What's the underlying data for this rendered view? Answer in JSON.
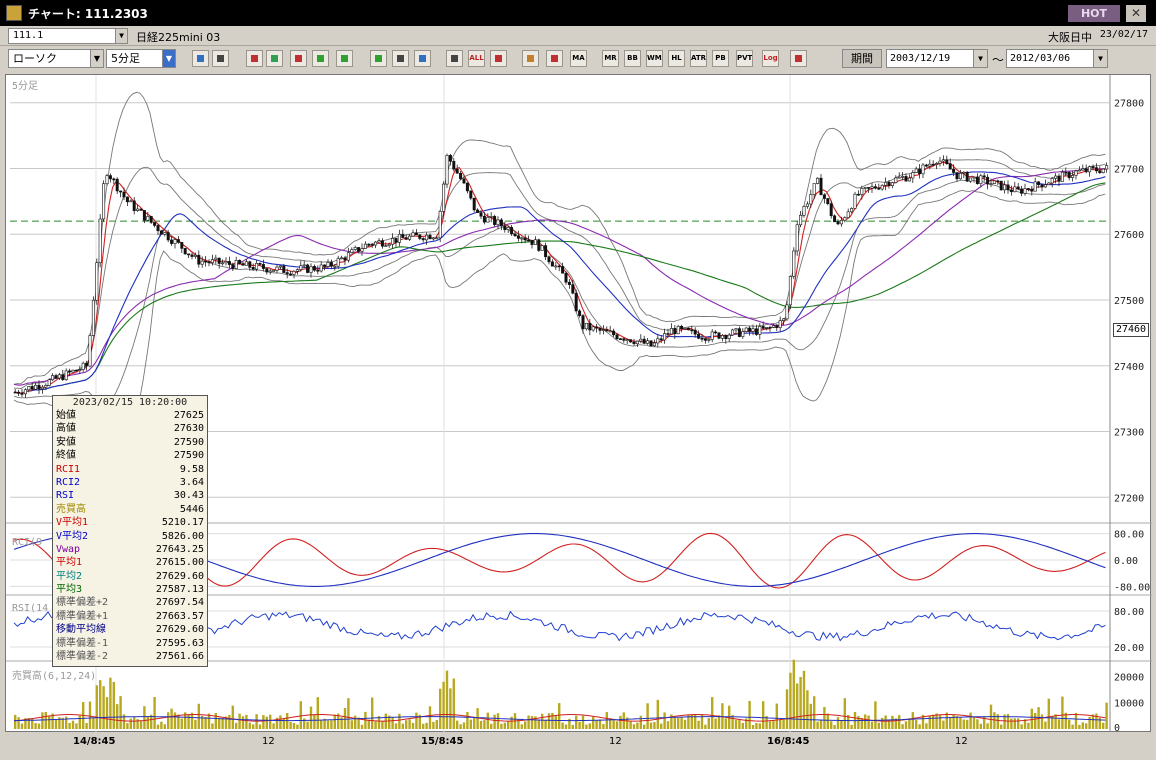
{
  "window": {
    "title": "チャート: 111.2303",
    "hot_label": "HOT",
    "close_label": "✕"
  },
  "symbol_bar": {
    "code": "111.1",
    "name": "日経225mini 03",
    "session": "大阪日中",
    "date": "23/02/17"
  },
  "toolbar": {
    "chart_type": "ローソク",
    "interval": "5分足",
    "icons": [
      "zoom-icon",
      "crosshair-icon",
      "draw-icon",
      "magnify-icon",
      "cursor-icon",
      "trend-icon",
      "fib-icon",
      "line-icon",
      "move-icon",
      "left-icon",
      "right-icon",
      "all-icon",
      "settings-icon",
      "tool-icon",
      "palette-icon",
      "ma-icon",
      "mr-icon",
      "bb-icon",
      "wma-icon",
      "hl-icon",
      "atr-icon",
      "pb-icon",
      "pvt-icon",
      "log-icon",
      "split-icon"
    ],
    "icon_labels": {
      "all": "ALL",
      "ma": "MA",
      "mr": "MR",
      "bb": "BB",
      "wma": "WMA",
      "hl": "HL",
      "atr": "ATR",
      "pb": "PB",
      "pvt": "PVT",
      "log": "Log"
    },
    "period_label": "期間",
    "date_from": "2003/12/19",
    "date_to": "2012/03/06",
    "tilde": "〜"
  },
  "panels": {
    "main_label": "5分足",
    "rci_label": "RCI(9",
    "rsi_label": "RSI(14",
    "vol_label": "売買高(6,12,24)",
    "price_ticks": [
      "27800",
      "27700",
      "27600",
      "27500",
      "27400",
      "27300",
      "27200"
    ],
    "current_price": "27460",
    "rci_ticks": [
      "80.00",
      "0.00",
      "-80.00"
    ],
    "rsi_ticks": [
      "80.00",
      "20.00"
    ],
    "vol_ticks": [
      "20000",
      "10000",
      "0"
    ]
  },
  "x_labels": [
    {
      "label": "14/8:45",
      "x": 90,
      "bold": true
    },
    {
      "label": "12",
      "x": 263,
      "bold": false
    },
    {
      "label": "15/8:45",
      "x": 438,
      "bold": true
    },
    {
      "label": "12",
      "x": 610,
      "bold": false
    },
    {
      "label": "16/8:45",
      "x": 784,
      "bold": true
    },
    {
      "label": "12",
      "x": 956,
      "bold": false
    }
  ],
  "data_window": {
    "timestamp": "2023/02/15  10:20:00",
    "rows": [
      {
        "label": "始値",
        "value": "27625",
        "color": "#000"
      },
      {
        "label": "高値",
        "value": "27630",
        "color": "#000"
      },
      {
        "label": "安値",
        "value": "27590",
        "color": "#000"
      },
      {
        "label": "終値",
        "value": "27590",
        "color": "#000"
      },
      {
        "label": "RCI1",
        "value": "9.58",
        "color": "#cc0000"
      },
      {
        "label": "RCI2",
        "value": "3.64",
        "color": "#0000cc"
      },
      {
        "label": "RSI",
        "value": "30.43",
        "color": "#0000cc"
      },
      {
        "label": "売買高",
        "value": "5446",
        "color": "#a08a00"
      },
      {
        "label": "V平均1",
        "value": "5210.17",
        "color": "#cc0000"
      },
      {
        "label": "V平均2",
        "value": "5826.00",
        "color": "#0000cc"
      },
      {
        "label": "Vwap",
        "value": "27643.25",
        "color": "#7a00a0"
      },
      {
        "label": "平均1",
        "value": "27615.00",
        "color": "#cc0000"
      },
      {
        "label": "平均2",
        "value": "27629.60",
        "color": "#008080"
      },
      {
        "label": "平均3",
        "value": "27587.13",
        "color": "#006600"
      },
      {
        "label": "標準偏差+2",
        "value": "27697.54",
        "color": "#555"
      },
      {
        "label": "標準偏差+1",
        "value": "27663.57",
        "color": "#555"
      },
      {
        "label": "移動平均線",
        "value": "27629.60",
        "color": "#000088"
      },
      {
        "label": "標準偏差-1",
        "value": "27595.63",
        "color": "#555"
      },
      {
        "label": "標準偏差-2",
        "value": "27561.66",
        "color": "#555"
      }
    ]
  },
  "chart_data": {
    "type": "candlestick",
    "ylim": [
      27170,
      27830
    ],
    "dashed_level": 27620,
    "anchors": [
      {
        "x": 8,
        "p": 27360
      },
      {
        "x": 40,
        "p": 27375
      },
      {
        "x": 80,
        "p": 27400
      },
      {
        "x": 98,
        "p": 27700
      },
      {
        "x": 120,
        "p": 27650
      },
      {
        "x": 150,
        "p": 27610
      },
      {
        "x": 175,
        "p": 27580
      },
      {
        "x": 190,
        "p": 27560
      },
      {
        "x": 220,
        "p": 27555
      },
      {
        "x": 250,
        "p": 27550
      },
      {
        "x": 280,
        "p": 27545
      },
      {
        "x": 320,
        "p": 27550
      },
      {
        "x": 360,
        "p": 27585
      },
      {
        "x": 400,
        "p": 27595
      },
      {
        "x": 430,
        "p": 27600
      },
      {
        "x": 440,
        "p": 27720
      },
      {
        "x": 455,
        "p": 27680
      },
      {
        "x": 470,
        "p": 27630
      },
      {
        "x": 500,
        "p": 27610
      },
      {
        "x": 530,
        "p": 27585
      },
      {
        "x": 560,
        "p": 27530
      },
      {
        "x": 575,
        "p": 27460
      },
      {
        "x": 600,
        "p": 27450
      },
      {
        "x": 625,
        "p": 27440
      },
      {
        "x": 645,
        "p": 27430
      },
      {
        "x": 665,
        "p": 27455
      },
      {
        "x": 700,
        "p": 27445
      },
      {
        "x": 730,
        "p": 27450
      },
      {
        "x": 760,
        "p": 27455
      },
      {
        "x": 778,
        "p": 27470
      },
      {
        "x": 790,
        "p": 27620
      },
      {
        "x": 810,
        "p": 27680
      },
      {
        "x": 830,
        "p": 27610
      },
      {
        "x": 850,
        "p": 27660
      },
      {
        "x": 880,
        "p": 27680
      },
      {
        "x": 905,
        "p": 27690
      },
      {
        "x": 930,
        "p": 27715
      },
      {
        "x": 950,
        "p": 27690
      },
      {
        "x": 980,
        "p": 27680
      },
      {
        "x": 1010,
        "p": 27665
      },
      {
        "x": 1040,
        "p": 27680
      },
      {
        "x": 1070,
        "p": 27695
      },
      {
        "x": 1100,
        "p": 27700
      }
    ]
  }
}
